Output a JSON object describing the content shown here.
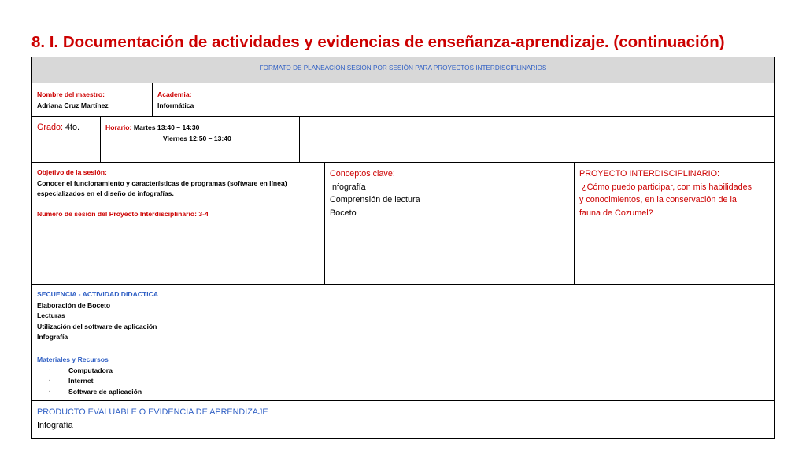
{
  "title": "8. I. Documentación de actividades y evidencias de enseñanza-aprendizaje. (continuación)",
  "form": {
    "header": "FORMATO DE PLANEACIÓN SESIÓN POR SESIÓN PARA PROYECTOS INTERDISCIPLINARIOS",
    "teacher_label": "Nombre del maestro:",
    "teacher_name": "Adriana Cruz Martínez",
    "academy_label": "Academia:",
    "academy_name": "Informática",
    "grade_label": "Grado:",
    "grade_value": "4to.",
    "schedule_label": "Horario:",
    "schedule_line1": "Martes  13:40 – 14:30",
    "schedule_line2": "Viernes 12:50 – 13:40",
    "objective_label": "Objetivo de la sesión:",
    "objective_line1": "Conocer el  funcionamiento y características de programas (software en línea)",
    "objective_line2": "especializados  en el  diseño de infografías.",
    "session_number": "Número de sesión del Proyecto Interdisciplinario: 3-4",
    "concepts_label": "Conceptos clave:",
    "concepts": [
      "Infografía",
      "Comprensión de lectura",
      "Boceto"
    ],
    "project_label": "PROYECTO INTERDISCIPLINARIO:",
    "project_question_line1": " ¿Cómo puedo participar, con mis habilidades",
    "project_question_line2": "y conocimientos, en la conservación de la",
    "project_question_line3": "fauna de Cozumel?",
    "sequence_label": "SECUENCIA - ACTIVIDAD DIDACTICA",
    "sequence_items": [
      "Elaboración de Boceto",
      "Lecturas",
      "Utilización del software de aplicación",
      "Infografía"
    ],
    "materials_label": "Materiales y Recursos",
    "materials_bullet": "·",
    "materials_items": [
      "Computadora",
      "Internet",
      "Software de aplicación"
    ],
    "product_label": "PRODUCTO EVALUABLE O EVIDENCIA DE APRENDIZAJE",
    "product_value": "Infografía"
  },
  "colors": {
    "title": "#cc0000",
    "red": "#cc0000",
    "blue": "#2f5fc4",
    "header_bg": "#d8d8d8"
  }
}
